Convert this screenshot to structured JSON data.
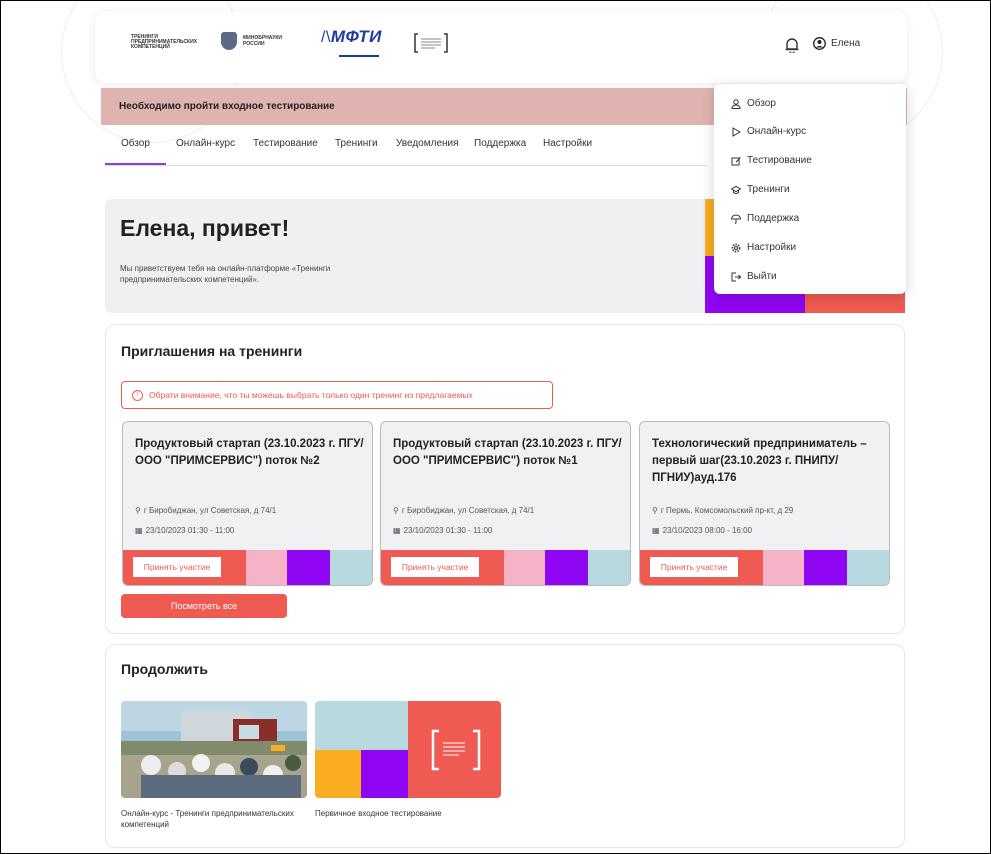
{
  "header": {
    "logos": {
      "trainings": "ТРЕНИНГИ ПРЕДПРИНИМАТЕЛЬСКИХ КОМПЕТЕНЦИЙ",
      "ministry": "МИНОБРНАУКИ РОССИИ",
      "mipt": "МФТИ"
    },
    "user_name": "Елена"
  },
  "alert": "Необходимо пройти входное тестирование",
  "tabs": [
    "Обзор",
    "Онлайн-курс",
    "Тестирование",
    "Тренинги",
    "Уведомления",
    "Поддержка",
    "Настройки"
  ],
  "dropdown": {
    "items": [
      "Обзор",
      "Онлайн-курс",
      "Тестирование",
      "Тренинги",
      "Поддержка",
      "Настройки",
      "Выйти"
    ]
  },
  "welcome": {
    "title": "Елена, привет!",
    "text": "Мы приветствуем тебя на онлайн-платформе «Тренинги предпринимательских компетенций»."
  },
  "invitations": {
    "title": "Приглашения на тренинги",
    "notice": "Обрати внимание, что ты можешь выбрать только один тренинг из предлагаемых",
    "cards": [
      {
        "title": "Продуктовый стартап (23.10.2023 г. ПГУ/ ООО \"ПРИМСЕРВИС\") поток №2",
        "location": "г Биробиджан, ул Советская, д 74/1",
        "datetime": "23/10/2023 01:30 - 11:00",
        "button": "Принять участие"
      },
      {
        "title": "Продуктовый стартап (23.10.2023 г. ПГУ/ ООО \"ПРИМСЕРВИС\") поток №1",
        "location": "г Биробиджан, ул Советская, д 74/1",
        "datetime": "23/10/2023 01:30 - 11:00",
        "button": "Принять участие"
      },
      {
        "title": "Технологический предприниматель – первый шаг(23.10.2023 г. ПНИПУ/ ПГНИУ)ауд.176",
        "location": "г Пермь, Комсомольский пр-кт, д 29",
        "datetime": "23/10/2023 08:00 - 16:00",
        "button": "Принять участие"
      }
    ],
    "view_all": "Посмотреть все"
  },
  "continue": {
    "title": "Продолжить",
    "items": [
      {
        "label": "Онлайн-курс - Тренинги предпринимательских компетенций"
      },
      {
        "label": "Первичное входное тестирование"
      }
    ]
  },
  "colors": {
    "accent_red": "#ef5b52",
    "purple": "#8f07f2",
    "pink": "#f6b3c8",
    "light_blue": "#b8d9df",
    "yellow": "#f9ad21",
    "alert_bg": "#dfb3b0"
  },
  "icons": {
    "bell": "bell-icon",
    "user": "user-circle-icon",
    "overview": "user-icon",
    "course": "play-icon",
    "test": "edit-icon",
    "trainings": "graduation-cap-icon",
    "support": "umbrella-icon",
    "settings": "gear-icon",
    "logout": "logout-icon",
    "location": "location-pin-icon",
    "calendar": "calendar-icon",
    "info": "info-icon"
  }
}
